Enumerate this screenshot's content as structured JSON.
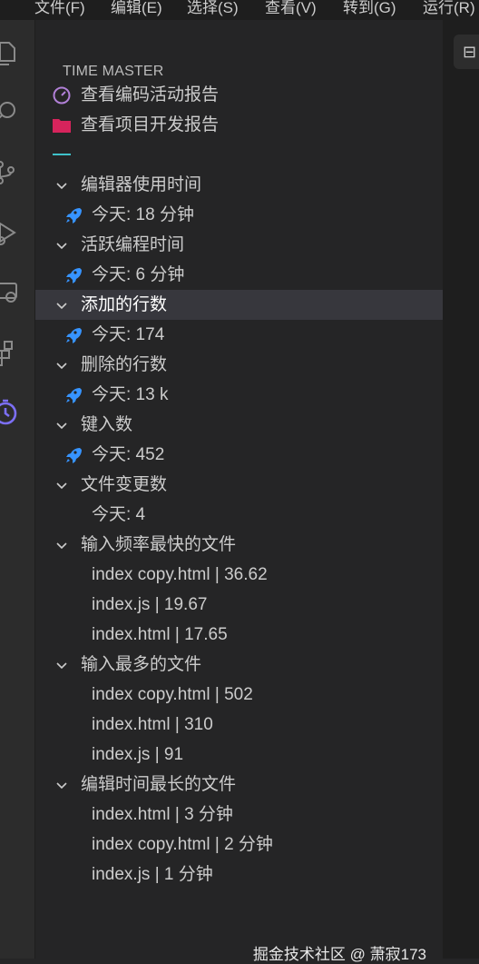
{
  "menubar": {
    "items": [
      "文件(F)",
      "编辑(E)",
      "选择(S)",
      "查看(V)",
      "转到(G)",
      "运行(R)"
    ]
  },
  "activity_bar": {
    "icons": [
      "files-icon",
      "search-icon",
      "source-control-icon",
      "run-debug-icon",
      "remote-explorer-icon",
      "extensions-icon",
      "time-master-icon"
    ],
    "active_color": "#7c6ff5"
  },
  "sidebar": {
    "title": "TIME MASTER",
    "actions": [
      {
        "label": "查看编码活动报告",
        "icon": "gauge-icon",
        "color": "#b180d7"
      },
      {
        "label": "查看项目开发报告",
        "icon": "folder-icon",
        "color": "#d6245c"
      }
    ],
    "tree": [
      {
        "label": "编辑器使用时间",
        "children": [
          {
            "label": "今天:  18 分钟",
            "icon": "rocket-icon"
          }
        ]
      },
      {
        "label": "活跃编程时间",
        "children": [
          {
            "label": "今天:  6 分钟",
            "icon": "rocket-icon"
          }
        ]
      },
      {
        "label": "添加的行数",
        "selected": true,
        "children": [
          {
            "label": "今天:  174",
            "icon": "rocket-icon"
          }
        ]
      },
      {
        "label": "删除的行数",
        "children": [
          {
            "label": "今天:  13 k",
            "icon": "rocket-icon"
          }
        ]
      },
      {
        "label": "键入数",
        "children": [
          {
            "label": "今天:  452",
            "icon": "rocket-icon"
          }
        ]
      },
      {
        "label": "文件变更数",
        "children": [
          {
            "label": "今天:  4"
          }
        ]
      },
      {
        "label": "输入频率最快的文件",
        "children": [
          {
            "label": "index copy.html | 36.62"
          },
          {
            "label": "index.js | 19.67"
          },
          {
            "label": "index.html | 17.65"
          }
        ]
      },
      {
        "label": "输入最多的文件",
        "children": [
          {
            "label": "index copy.html | 502"
          },
          {
            "label": "index.html | 310"
          },
          {
            "label": "index.js | 91"
          }
        ]
      },
      {
        "label": "编辑时间最长的文件",
        "children": [
          {
            "label": "index.html | 3 分钟"
          },
          {
            "label": "index copy.html | 2 分钟"
          },
          {
            "label": "index.js | 1 分钟"
          }
        ]
      }
    ]
  },
  "editor": {
    "tab_glyph": "⊟"
  },
  "watermark": "掘金技术社区 @ 萧寂173",
  "colors": {
    "rocket": "#3794ff",
    "separator": "#3fc1c9",
    "selected_row": "#37373d"
  }
}
